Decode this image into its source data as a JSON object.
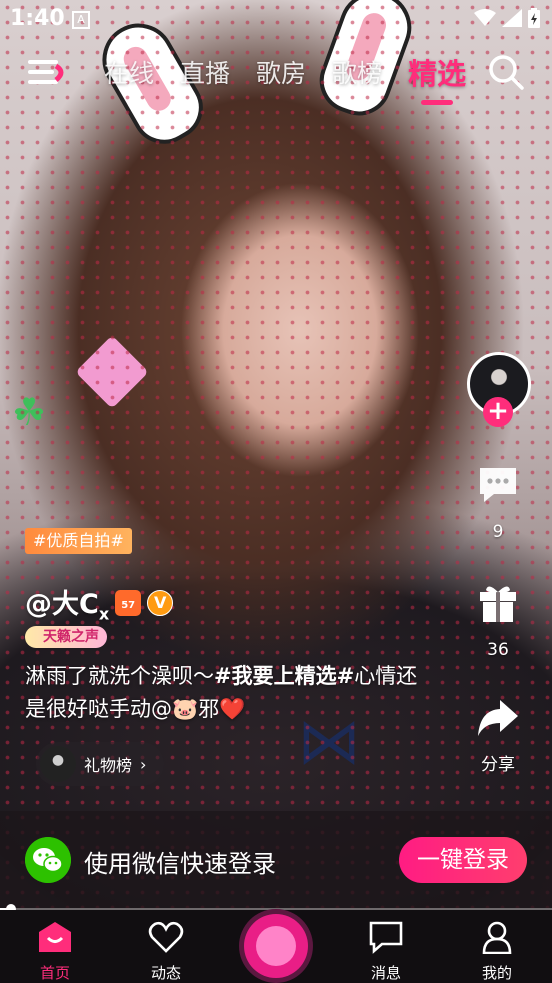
{
  "status_bar": {
    "time": "1:40",
    "notification_letter": "A"
  },
  "top_nav": {
    "tabs": [
      {
        "label": "在线",
        "active": false
      },
      {
        "label": "直播",
        "active": false
      },
      {
        "label": "歌房",
        "active": false
      },
      {
        "label": "歌榜",
        "active": false
      },
      {
        "label": "精选",
        "active": true
      }
    ]
  },
  "right_rail": {
    "comment_count": "9",
    "gift_count": "36",
    "share_label": "分享"
  },
  "post": {
    "topic_tag": "#优质自拍#",
    "author_name": "@大C",
    "author_subscript": "x",
    "level": "57",
    "verified_mark": "V",
    "honor_badge": "天籁之声",
    "caption_part1": "淋雨了就洗个澡呗～",
    "caption_hashtag": "#我要上精选#",
    "caption_part2": "心情还是很好哒手动@🐷邪",
    "caption_emoji": "❤️",
    "gift_rank_label": "礼物榜",
    "gift_rank_arrow": "›"
  },
  "login_bar": {
    "text": "使用微信快速登录",
    "button": "一键登录"
  },
  "playback": {
    "progress_fraction": 0.02
  },
  "bottom_nav": {
    "items": [
      {
        "label": "首页",
        "icon": "home-icon",
        "active": true
      },
      {
        "label": "动态",
        "icon": "heart-icon",
        "active": false
      },
      {
        "label": "消息",
        "icon": "message-icon",
        "active": false
      },
      {
        "label": "我的",
        "icon": "profile-icon",
        "active": false
      }
    ]
  },
  "colors": {
    "accent": "#ff2d7b",
    "wechat": "#2dc100",
    "tag_orange": "#ff8a3d"
  }
}
